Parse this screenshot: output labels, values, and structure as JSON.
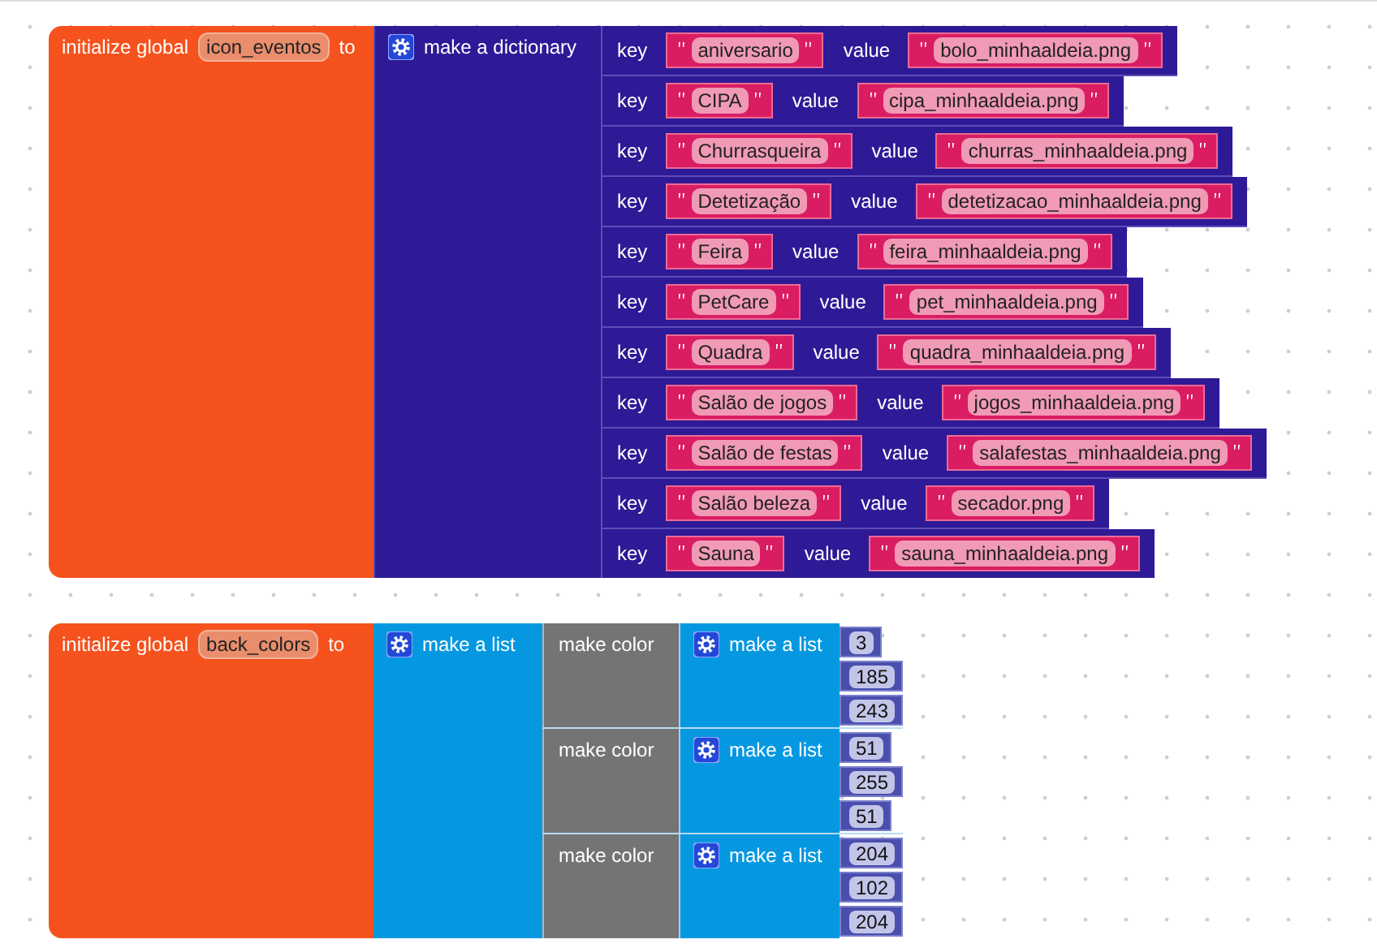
{
  "blocks": [
    {
      "kind": "dictionary",
      "keyword": "initialize global",
      "name": "icon_eventos",
      "to": "to",
      "constructor": "make a dictionary",
      "pairs": [
        {
          "key_label": "key",
          "key": "aniversario",
          "value_label": "value",
          "value": "bolo_minhaaldeia.png"
        },
        {
          "key_label": "key",
          "key": "CIPA",
          "value_label": "value",
          "value": "cipa_minhaaldeia.png"
        },
        {
          "key_label": "key",
          "key": "Churrasqueira",
          "value_label": "value",
          "value": "churras_minhaaldeia.png"
        },
        {
          "key_label": "key",
          "key": "Detetização",
          "value_label": "value",
          "value": "detetizacao_minhaaldeia.png"
        },
        {
          "key_label": "key",
          "key": "Feira",
          "value_label": "value",
          "value": "feira_minhaaldeia.png"
        },
        {
          "key_label": "key",
          "key": "PetCare",
          "value_label": "value",
          "value": "pet_minhaaldeia.png"
        },
        {
          "key_label": "key",
          "key": "Quadra",
          "value_label": "value",
          "value": "quadra_minhaaldeia.png"
        },
        {
          "key_label": "key",
          "key": "Salão de jogos",
          "value_label": "value",
          "value": "jogos_minhaaldeia.png"
        },
        {
          "key_label": "key",
          "key": "Salão de festas",
          "value_label": "value",
          "value": "salafestas_minhaaldeia.png"
        },
        {
          "key_label": "key",
          "key": "Salão beleza",
          "value_label": "value",
          "value": "secador.png"
        },
        {
          "key_label": "key",
          "key": "Sauna",
          "value_label": "value",
          "value": "sauna_minhaaldeia.png"
        }
      ]
    },
    {
      "kind": "list",
      "keyword": "initialize global",
      "name": "back_colors",
      "to": "to",
      "constructor": "make a list",
      "items": [
        {
          "label": "make color",
          "list_label": "make a list",
          "numbers": [
            "3",
            "185",
            "243"
          ]
        },
        {
          "label": "make color",
          "list_label": "make a list",
          "numbers": [
            "51",
            "255",
            "51"
          ]
        },
        {
          "label": "make color",
          "list_label": "make a list",
          "numbers": [
            "204",
            "102",
            "204"
          ]
        }
      ]
    }
  ]
}
